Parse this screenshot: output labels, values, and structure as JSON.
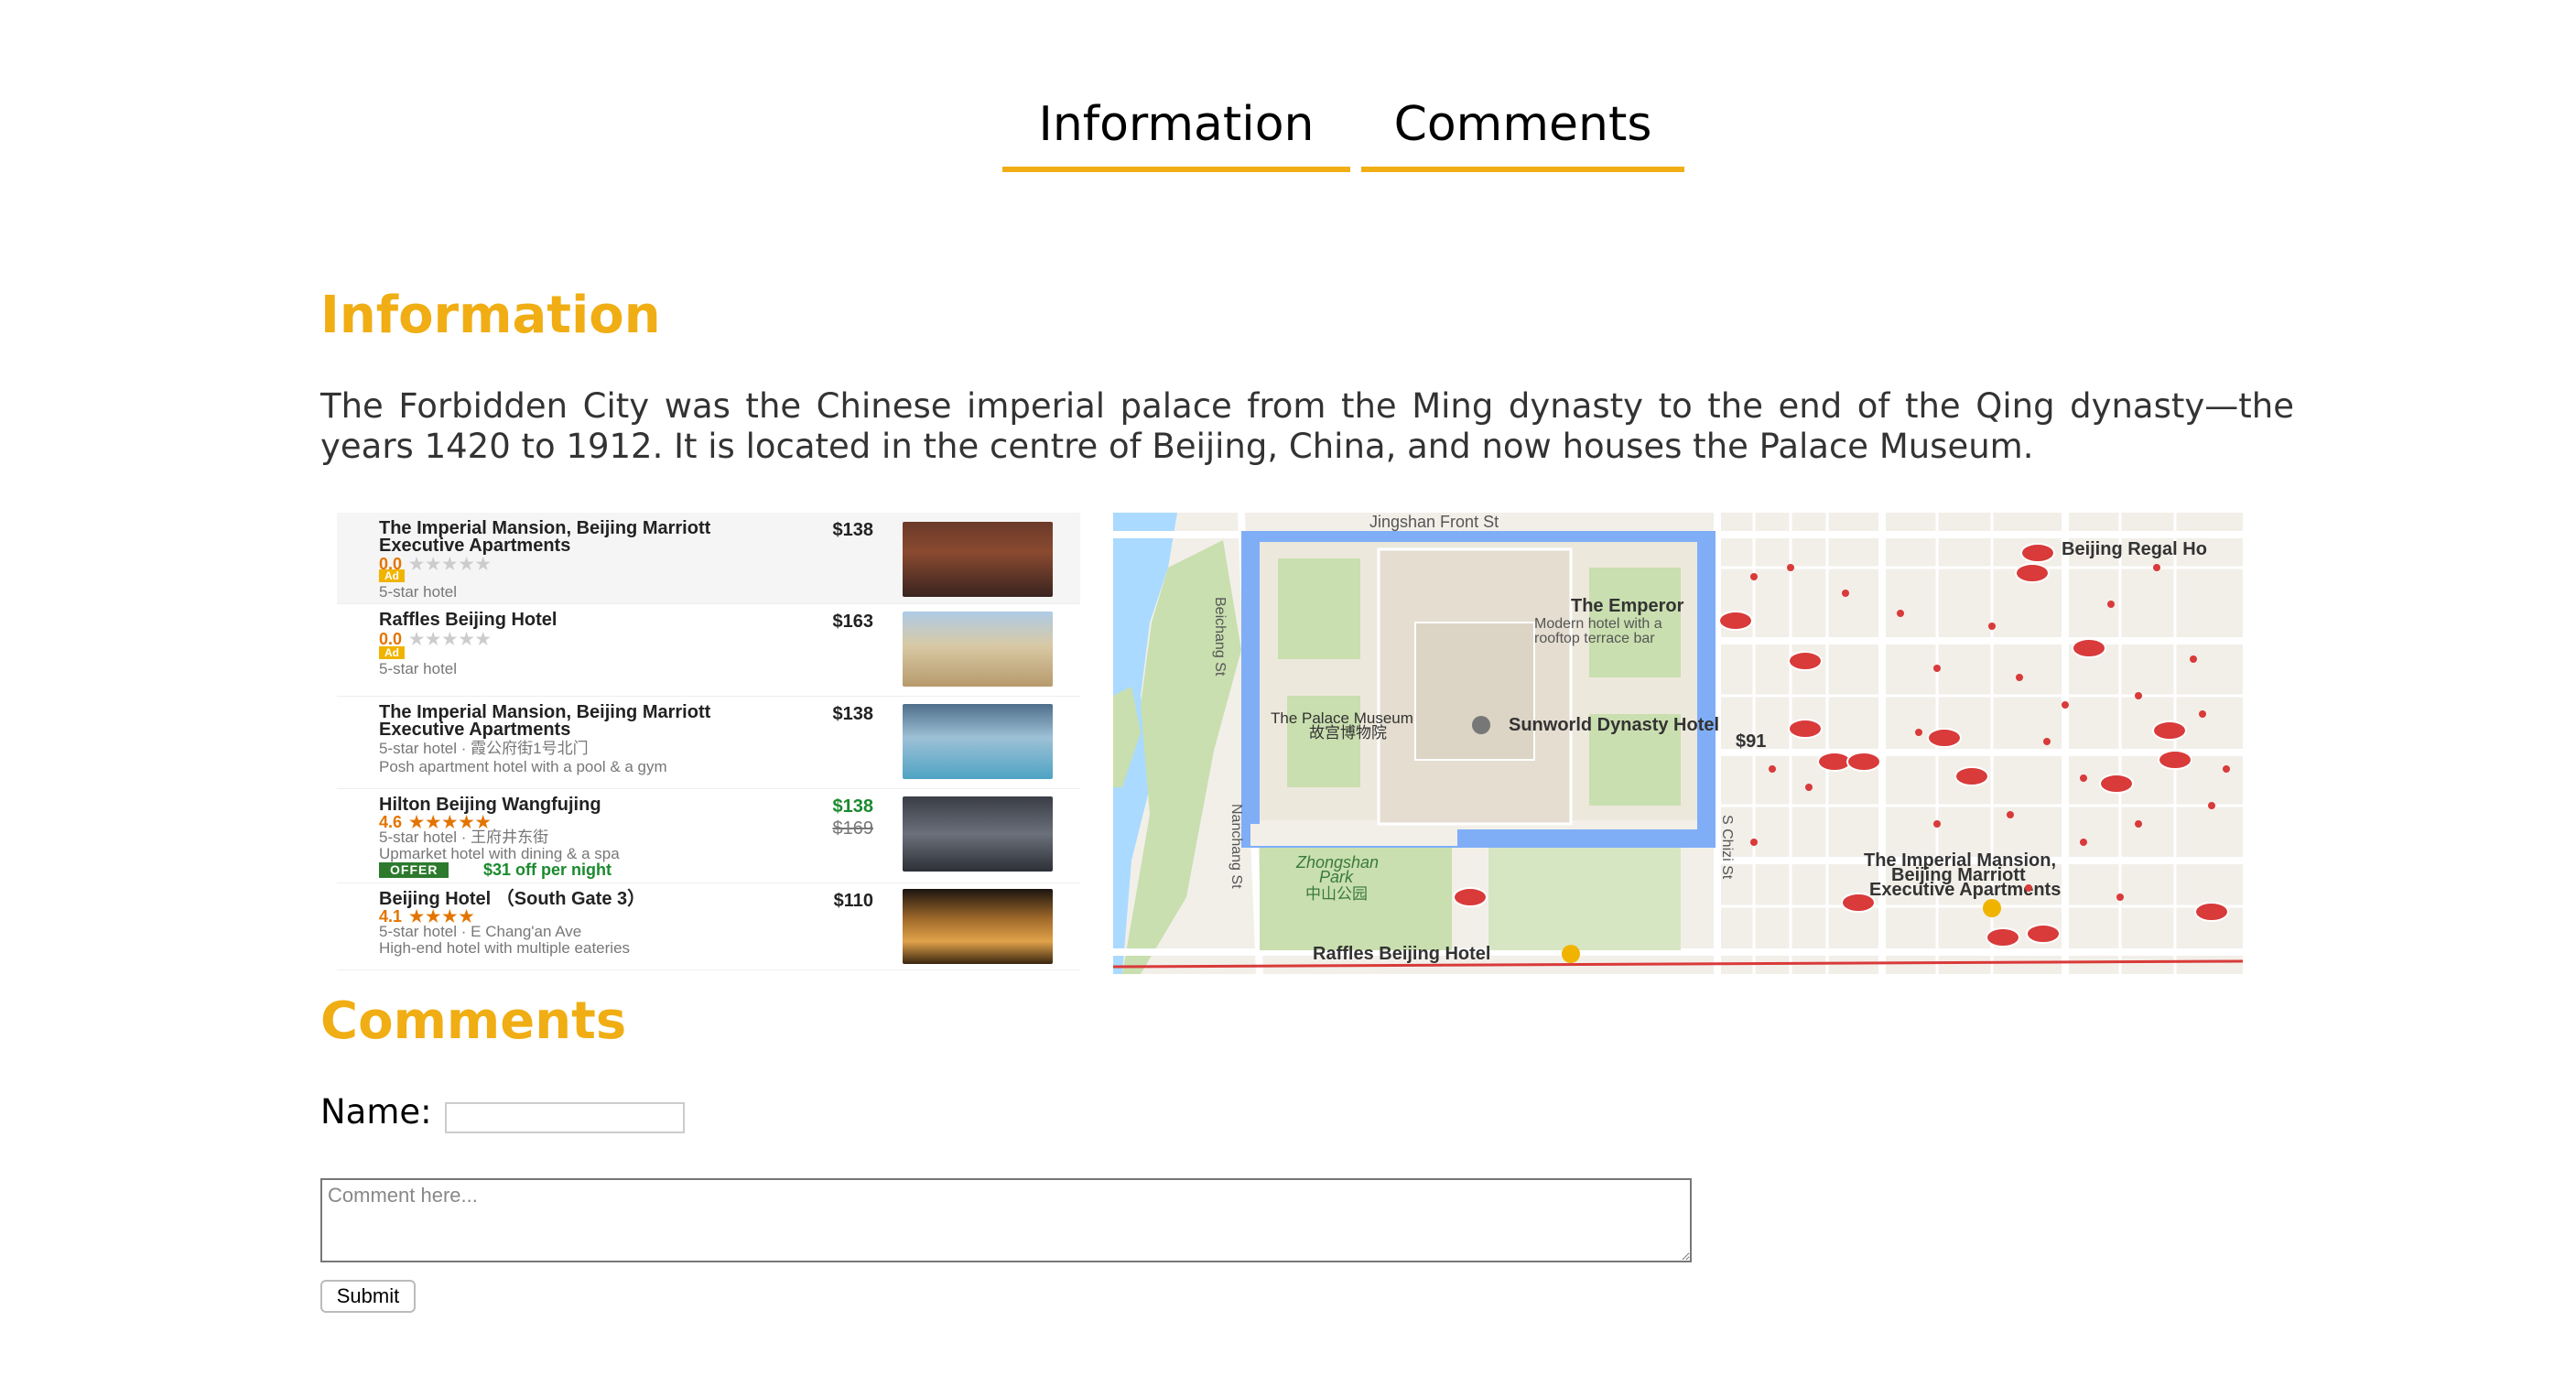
{
  "tabs": [
    {
      "label": "Information"
    },
    {
      "label": "Comments"
    }
  ],
  "information": {
    "heading": "Information",
    "description": "The Forbidden City was the Chinese imperial palace from the Ming dynasty to the end of the Qing dynasty—the years 1420 to 1912. It is located in the centre of Beijing, China, and now houses the Palace Museum."
  },
  "hotels": [
    {
      "name": "The Imperial Mansion, Beijing Marriott Executive Apartments",
      "price": "$138",
      "rating": "0.0",
      "badge": "Ad",
      "meta": "5-star hotel"
    },
    {
      "name": "Raffles Beijing Hotel",
      "price": "$163",
      "rating": "0.0",
      "badge": "Ad",
      "meta": "5-star hotel"
    },
    {
      "name": "The Imperial Mansion, Beijing Marriott Executive Apartments",
      "price": "$138",
      "meta": "5-star hotel · 霞公府街1号北门",
      "desc": "Posh apartment hotel with a pool & a gym"
    },
    {
      "name": "Hilton Beijing Wangfujing",
      "price": "$138",
      "old_price": "$169",
      "rating": "4.6",
      "meta": "5-star hotel · 王府井东街",
      "desc": "Upmarket hotel with dining & a spa",
      "offer_badge": "OFFER",
      "offer_text": "$31 off per night"
    },
    {
      "name": "Beijing Hotel （South Gate 3）",
      "price": "$110",
      "rating": "4.1",
      "meta": "5-star hotel · E Chang'an Ave",
      "desc": "High-end hotel with multiple eateries"
    }
  ],
  "map": {
    "labels": {
      "jingshan": "Jingshan Front St",
      "beichang": "Beichang St",
      "nanchang": "Nanchang St",
      "nanchizi": "S Chizi St",
      "emperor": "The Emperor",
      "emperor_desc1": "Modern hotel with a",
      "emperor_desc2": "rooftop terrace bar",
      "palace": "The Palace Museum",
      "palace_cn": "故宫博物院",
      "sunworld": "Sunworld Dynasty Hotel",
      "sunworld_price": "$91",
      "zhongshan1": "Zhongshan",
      "zhongshan2": "Park",
      "zhongshan_cn": "中山公园",
      "raffles": "Raffles Beijing Hotel",
      "regal": "Beijing Regal Ho",
      "imperial1": "The Imperial Mansion,",
      "imperial2": "Beijing Marriott",
      "imperial3": "Executive Apartments"
    }
  },
  "comments": {
    "heading": "Comments",
    "name_label": "Name:",
    "name_value": "",
    "comment_placeholder": "Comment here...",
    "submit_label": "Submit"
  },
  "colors": {
    "accent": "#F0AE14",
    "water": "#7faef7",
    "park": "#c9dfaf",
    "marker": "#d93a3a"
  }
}
